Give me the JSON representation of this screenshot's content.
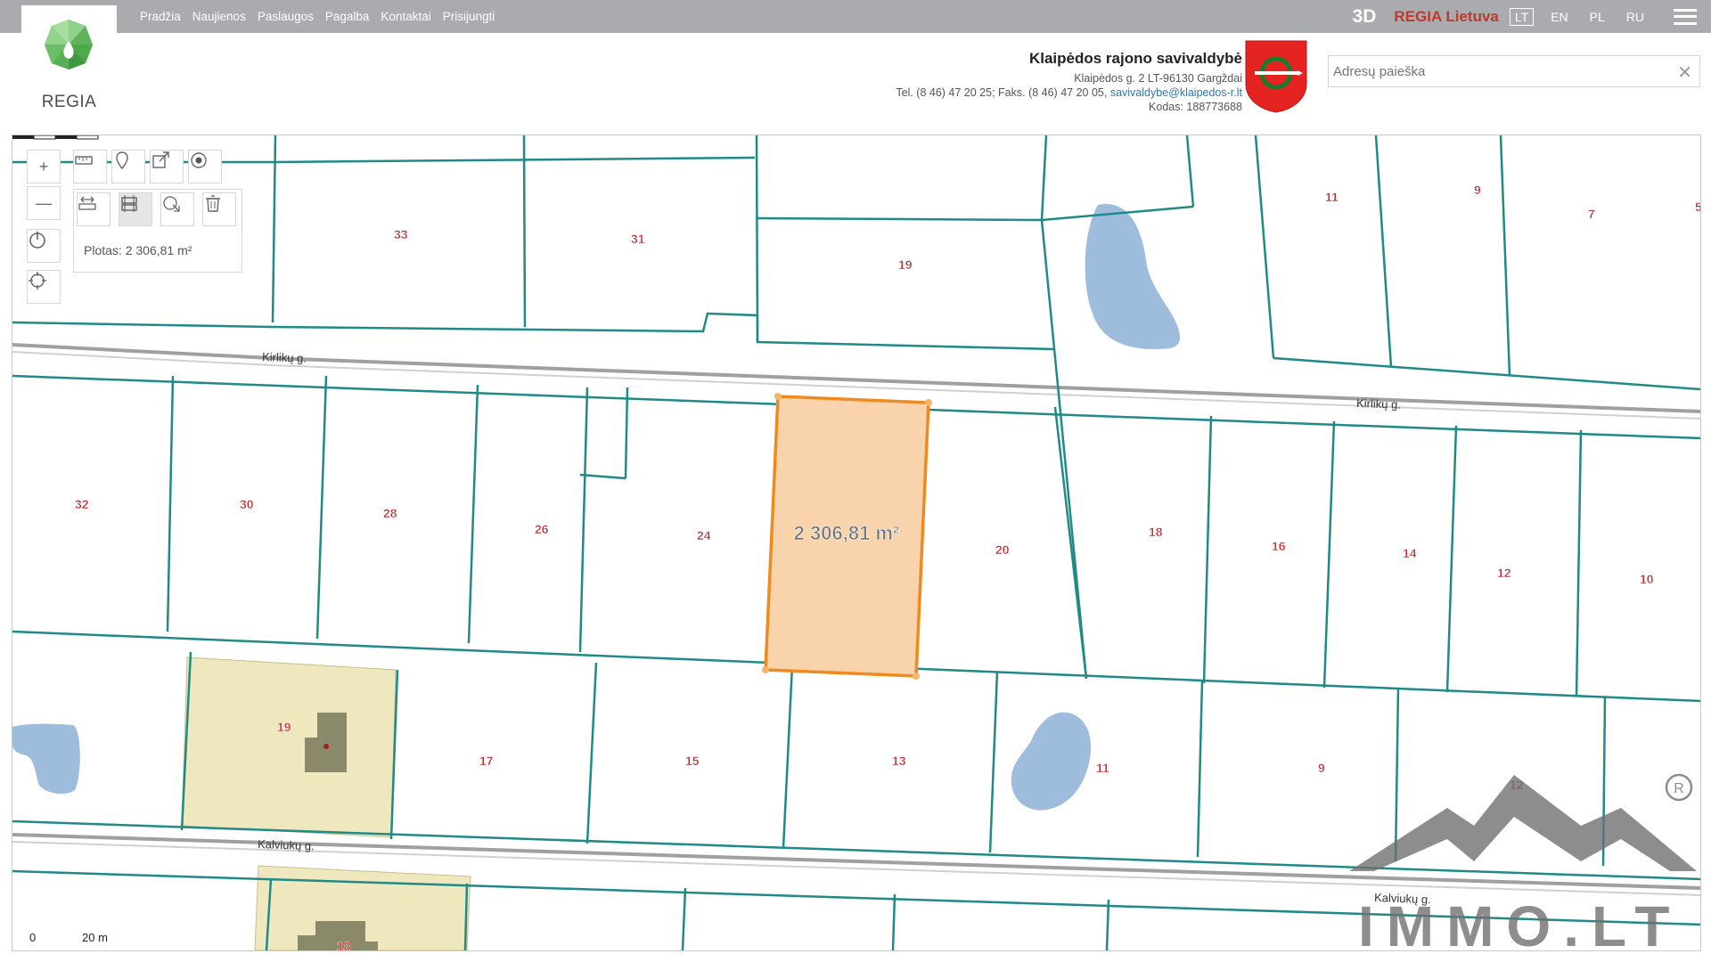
{
  "brand": {
    "logo_text": "REGIA"
  },
  "nav": {
    "items": [
      "Pradžia",
      "Naujienos",
      "Paslaugos",
      "Pagalba",
      "Kontaktai",
      "Prisijungti"
    ]
  },
  "top_right": {
    "btn_3d": "3D",
    "regia_lietuva": "REGIA Lietuva",
    "languages": [
      "LT",
      "EN",
      "PL",
      "RU"
    ],
    "active_language": "LT"
  },
  "municipality": {
    "name": "Klaipėdos rajono savivaldybė",
    "address": "Klaipėdos g. 2 LT-96130 Gargždai",
    "phones": "Tel. (8 46) 47 20 25; Faks. (8 46) 47 20 05,",
    "email": "savivaldybe@klaipedos-r.lt",
    "code": "Kodas: 188773688"
  },
  "search": {
    "placeholder": "Adresų paieška"
  },
  "tools": {
    "zoom_in": "+",
    "zoom_out": "—",
    "area_result": "Plotas: 2 306,81 m²"
  },
  "map": {
    "selected_area_label": "2 306,81 m²",
    "streets": [
      "Kirlikų g.",
      "Kirlikų g.",
      "Kalviukų g.",
      "Kalviukų g."
    ],
    "parcel_numbers": [
      "33",
      "31",
      "19",
      "11",
      "9",
      "7",
      "5",
      "32",
      "30",
      "28",
      "26",
      "24",
      "20",
      "18",
      "16",
      "14",
      "12",
      "10",
      "19",
      "17",
      "15",
      "13",
      "11",
      "9",
      "18",
      "12"
    ],
    "scale": {
      "zero": "0",
      "distance": "20 m"
    },
    "watermark": "IMMO.LT",
    "colors": {
      "parcel_line": "#1f8a86",
      "selected_fill": "#f8d3ac",
      "selected_stroke": "#ef8a1e",
      "building_zone": "#efe7be",
      "building": "#8a8a6a",
      "water": "#9ebcdc",
      "street": "#a0a0a0",
      "parcel_number": "#c0262a"
    }
  }
}
